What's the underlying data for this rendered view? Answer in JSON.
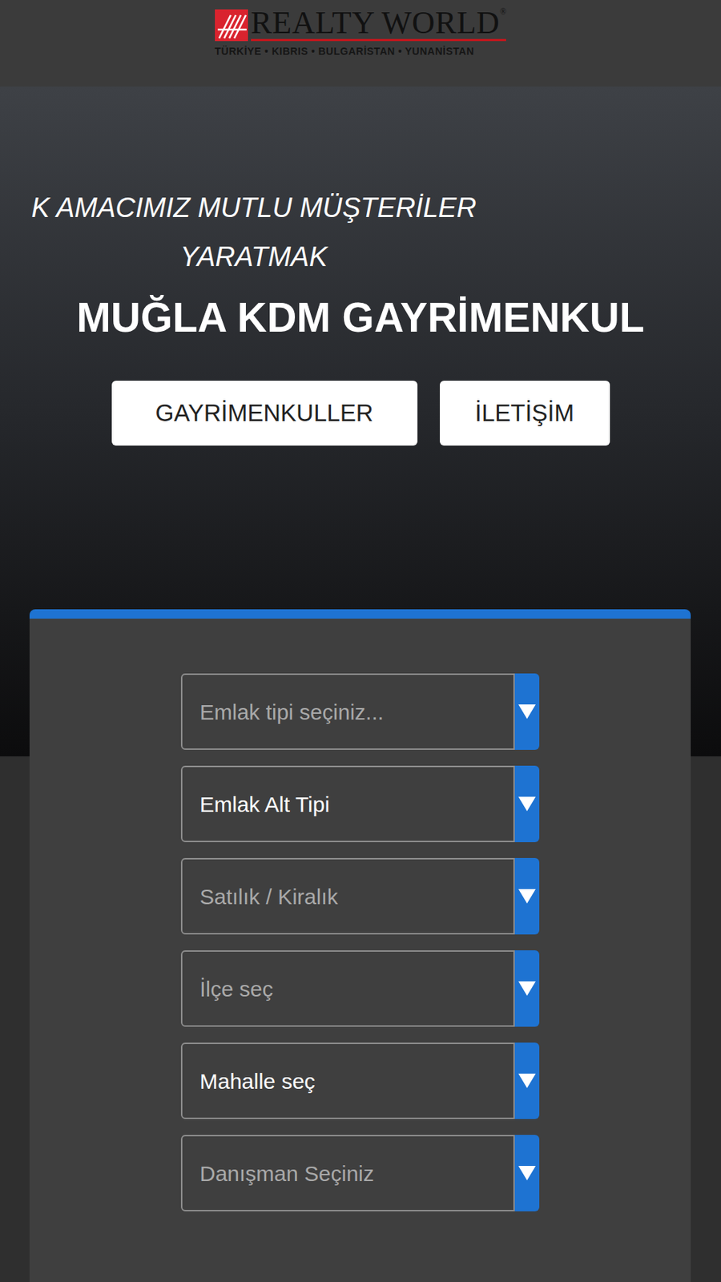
{
  "header": {
    "logo": {
      "brand": "REALTY WORLD",
      "registered": "®",
      "subtitle": "TÜRKİYE • KIBRIS • BULGARİSTAN • YUNANİSTAN"
    }
  },
  "hero": {
    "tagline": [
      "K AMACIMIZ MUTLU MÜŞTERİLER",
      "YARATMAK"
    ],
    "title": "MUĞLA KDM GAYRİMENKUL",
    "buttons": [
      "GAYRİMENKULLER",
      "İLETİŞİM"
    ]
  },
  "search": {
    "fields": [
      {
        "label": "Emlak tipi seçiniz...",
        "dimmed": true
      },
      {
        "label": "Emlak Alt Tipi",
        "dimmed": false
      },
      {
        "label": "Satılık / Kiralık",
        "dimmed": true
      },
      {
        "label": "İlçe seç",
        "dimmed": true
      },
      {
        "label": "Mahalle seç",
        "dimmed": false
      },
      {
        "label": "Danışman Seçiniz",
        "dimmed": true
      }
    ]
  }
}
